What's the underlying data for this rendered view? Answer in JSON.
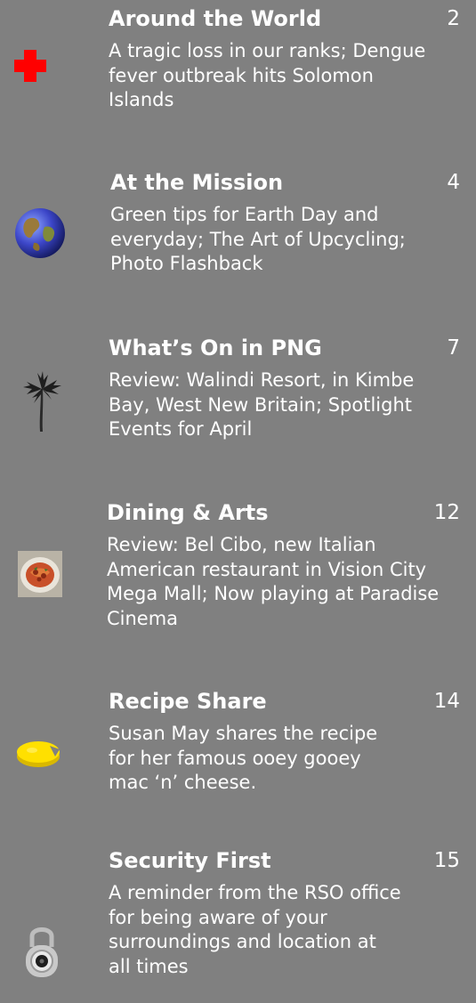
{
  "toc": {
    "entries": [
      {
        "title": "Around the World",
        "page": "2",
        "description": "A tragic loss in our ranks; Dengue fever outbreak hits Solomon Islands",
        "icon": "red-cross-icon"
      },
      {
        "title": "At the Mission",
        "page": "4",
        "description": "Green tips for Earth Day and everyday; The Art of Upcycling; Photo Flashback",
        "icon": "globe-icon"
      },
      {
        "title": "What’s On in PNG",
        "page": "7",
        "description": "Review: Walindi Resort, in Kimbe Bay, West New Britain; Spotlight Events for April",
        "icon": "palm-tree-icon"
      },
      {
        "title": "Dining & Arts",
        "page": "12",
        "description": "Review: Bel Cibo, new Italian American restaurant in Vision City Mega Mall; Now playing at Paradise Cinema",
        "icon": "pasta-dish-icon"
      },
      {
        "title": "Recipe Share",
        "page": "14",
        "description": "Susan May shares the recipe for her famous ooey gooey mac ‘n’ cheese.",
        "icon": "cheese-icon"
      },
      {
        "title": "Security First",
        "page": "15",
        "description": "A reminder from the RSO office for being aware of your surroundings and location at all times",
        "icon": "padlock-icon"
      }
    ]
  }
}
